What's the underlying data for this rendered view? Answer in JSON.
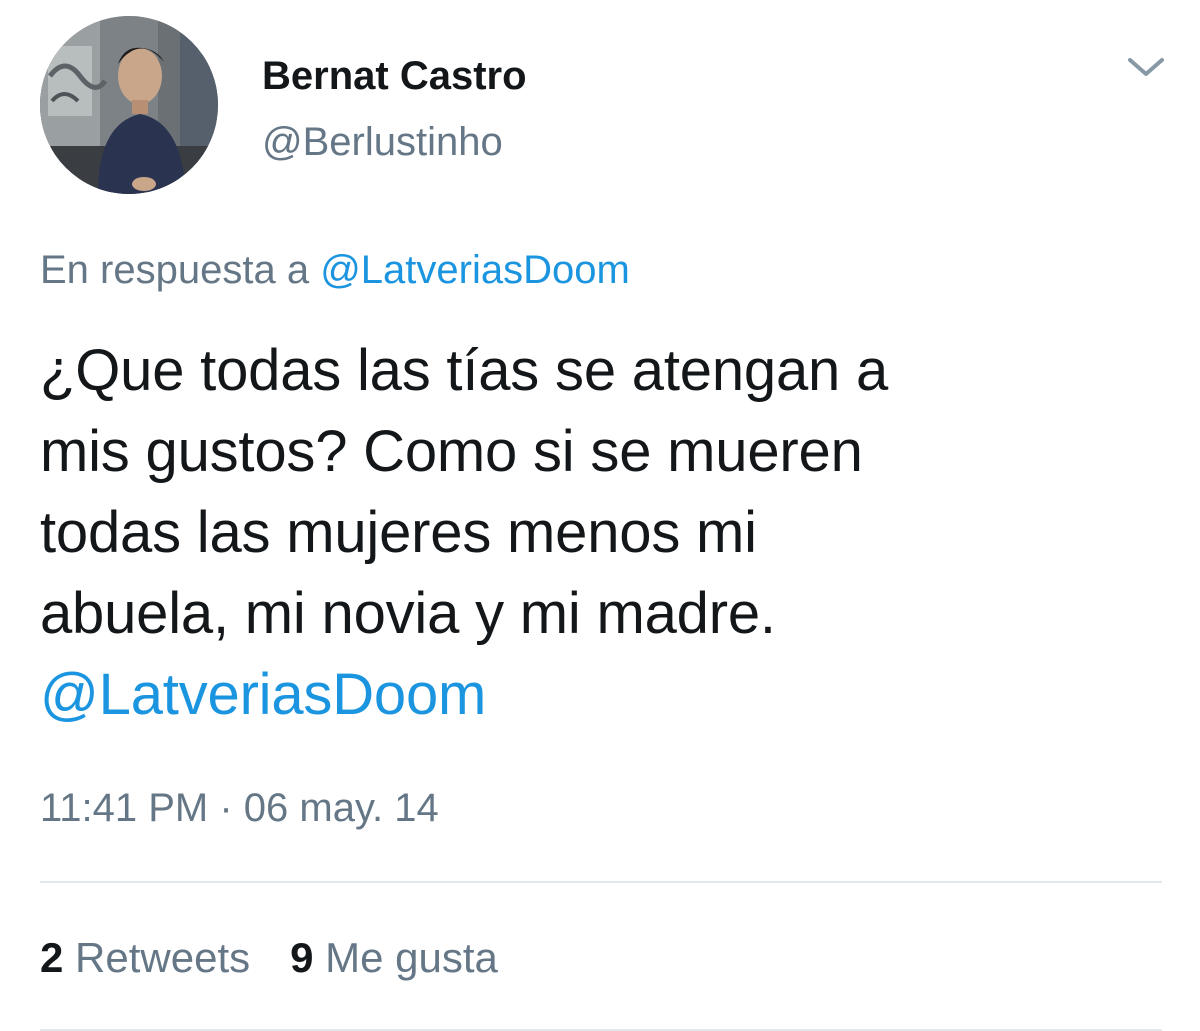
{
  "user": {
    "display_name": "Bernat Castro",
    "handle": "@Berlustinho"
  },
  "icons": {
    "avatar": "profile-photo",
    "menu": "chevron-down-icon"
  },
  "reply": {
    "prefix": "En respuesta a",
    "mention": "@LatveriasDoom"
  },
  "tweet": {
    "lines": [
      "¿Que todas las tías se atengan a",
      "mis gustos? Como si se mueren",
      "todas las mujeres menos mi",
      "abuela, mi novia y mi madre."
    ],
    "mention": "@LatveriasDoom"
  },
  "timestamp": "11:41 PM · 06 may. 14",
  "stats": {
    "retweets_count": "2",
    "retweets_label": "Retweets",
    "likes_count": "9",
    "likes_label": "Me gusta"
  },
  "colors": {
    "text": "#14171a",
    "secondary": "#657786",
    "link": "#1b95e0",
    "divider": "#e1e8ed"
  }
}
